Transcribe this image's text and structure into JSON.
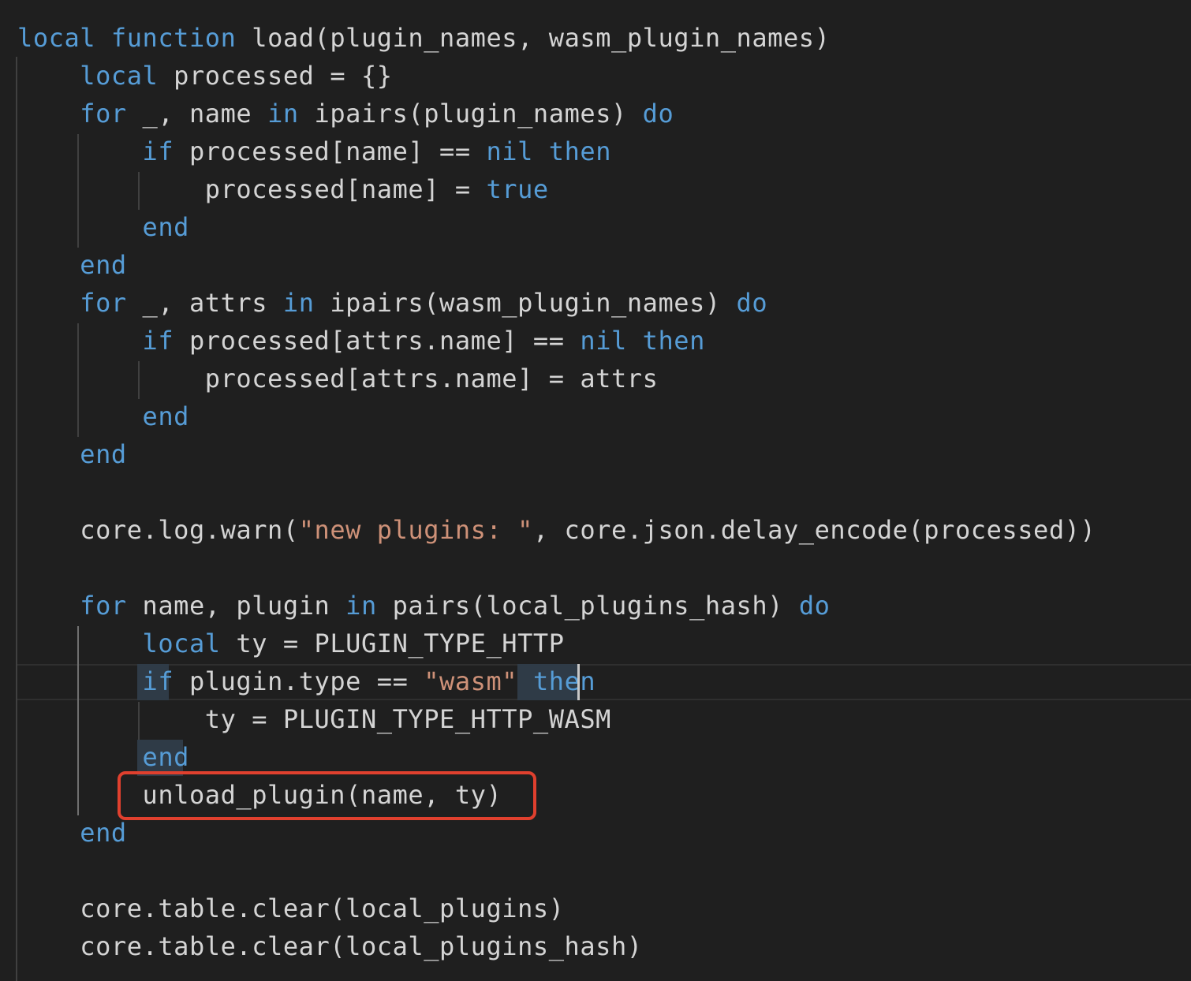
{
  "editor": {
    "language": "lua",
    "colors": {
      "background": "#1f1f1f",
      "keyword": "#569cd6",
      "string": "#ce9178",
      "identifier": "#d4d4d4",
      "annotation": "#e0402e"
    },
    "lines": [
      [
        {
          "t": "kw",
          "v": "local"
        },
        {
          "t": "id",
          "v": " "
        },
        {
          "t": "kw",
          "v": "function"
        },
        {
          "t": "id",
          "v": " load(plugin_names, wasm_plugin_names)"
        }
      ],
      [
        {
          "t": "id",
          "v": "    "
        },
        {
          "t": "kw",
          "v": "local"
        },
        {
          "t": "id",
          "v": " processed = {}"
        }
      ],
      [
        {
          "t": "id",
          "v": "    "
        },
        {
          "t": "kw",
          "v": "for"
        },
        {
          "t": "id",
          "v": " _, name "
        },
        {
          "t": "kw",
          "v": "in"
        },
        {
          "t": "id",
          "v": " ipairs(plugin_names) "
        },
        {
          "t": "kw",
          "v": "do"
        }
      ],
      [
        {
          "t": "id",
          "v": "        "
        },
        {
          "t": "kw",
          "v": "if"
        },
        {
          "t": "id",
          "v": " processed[name] == "
        },
        {
          "t": "kw",
          "v": "nil"
        },
        {
          "t": "id",
          "v": " "
        },
        {
          "t": "kw",
          "v": "then"
        }
      ],
      [
        {
          "t": "id",
          "v": "            processed[name] = "
        },
        {
          "t": "kw",
          "v": "true"
        }
      ],
      [
        {
          "t": "id",
          "v": "        "
        },
        {
          "t": "kw",
          "v": "end"
        }
      ],
      [
        {
          "t": "id",
          "v": "    "
        },
        {
          "t": "kw",
          "v": "end"
        }
      ],
      [
        {
          "t": "id",
          "v": "    "
        },
        {
          "t": "kw",
          "v": "for"
        },
        {
          "t": "id",
          "v": " _, attrs "
        },
        {
          "t": "kw",
          "v": "in"
        },
        {
          "t": "id",
          "v": " ipairs(wasm_plugin_names) "
        },
        {
          "t": "kw",
          "v": "do"
        }
      ],
      [
        {
          "t": "id",
          "v": "        "
        },
        {
          "t": "kw",
          "v": "if"
        },
        {
          "t": "id",
          "v": " processed[attrs.name] == "
        },
        {
          "t": "kw",
          "v": "nil"
        },
        {
          "t": "id",
          "v": " "
        },
        {
          "t": "kw",
          "v": "then"
        }
      ],
      [
        {
          "t": "id",
          "v": "            processed[attrs.name] = attrs"
        }
      ],
      [
        {
          "t": "id",
          "v": "        "
        },
        {
          "t": "kw",
          "v": "end"
        }
      ],
      [
        {
          "t": "id",
          "v": "    "
        },
        {
          "t": "kw",
          "v": "end"
        }
      ],
      [],
      [
        {
          "t": "id",
          "v": "    core.log.warn("
        },
        {
          "t": "str",
          "v": "\"new plugins: \""
        },
        {
          "t": "id",
          "v": ", core.json.delay_encode(processed))"
        }
      ],
      [],
      [
        {
          "t": "id",
          "v": "    "
        },
        {
          "t": "kw",
          "v": "for"
        },
        {
          "t": "id",
          "v": " name, plugin "
        },
        {
          "t": "kw",
          "v": "in"
        },
        {
          "t": "id",
          "v": " pairs(local_plugins_hash) "
        },
        {
          "t": "kw",
          "v": "do"
        }
      ],
      [
        {
          "t": "id",
          "v": "        "
        },
        {
          "t": "kw",
          "v": "local"
        },
        {
          "t": "id",
          "v": " ty = PLUGIN_TYPE_HTTP"
        }
      ],
      [
        {
          "t": "id",
          "v": "        "
        },
        {
          "t": "kw",
          "v": "if"
        },
        {
          "t": "id",
          "v": " plugin.type == "
        },
        {
          "t": "str",
          "v": "\"wasm\""
        },
        {
          "t": "id",
          "v": " "
        },
        {
          "t": "kw",
          "v": "then"
        }
      ],
      [
        {
          "t": "id",
          "v": "            ty = PLUGIN_TYPE_HTTP_WASM"
        }
      ],
      [
        {
          "t": "id",
          "v": "        "
        },
        {
          "t": "kw",
          "v": "end"
        }
      ],
      [
        {
          "t": "id",
          "v": "        unload_plugin(name, ty)"
        }
      ],
      [
        {
          "t": "id",
          "v": "    "
        },
        {
          "t": "kw",
          "v": "end"
        }
      ],
      [],
      [
        {
          "t": "id",
          "v": "    core.table.clear(local_plugins)"
        }
      ],
      [
        {
          "t": "id",
          "v": "    core.table.clear(local_plugins_hash)"
        }
      ]
    ]
  }
}
